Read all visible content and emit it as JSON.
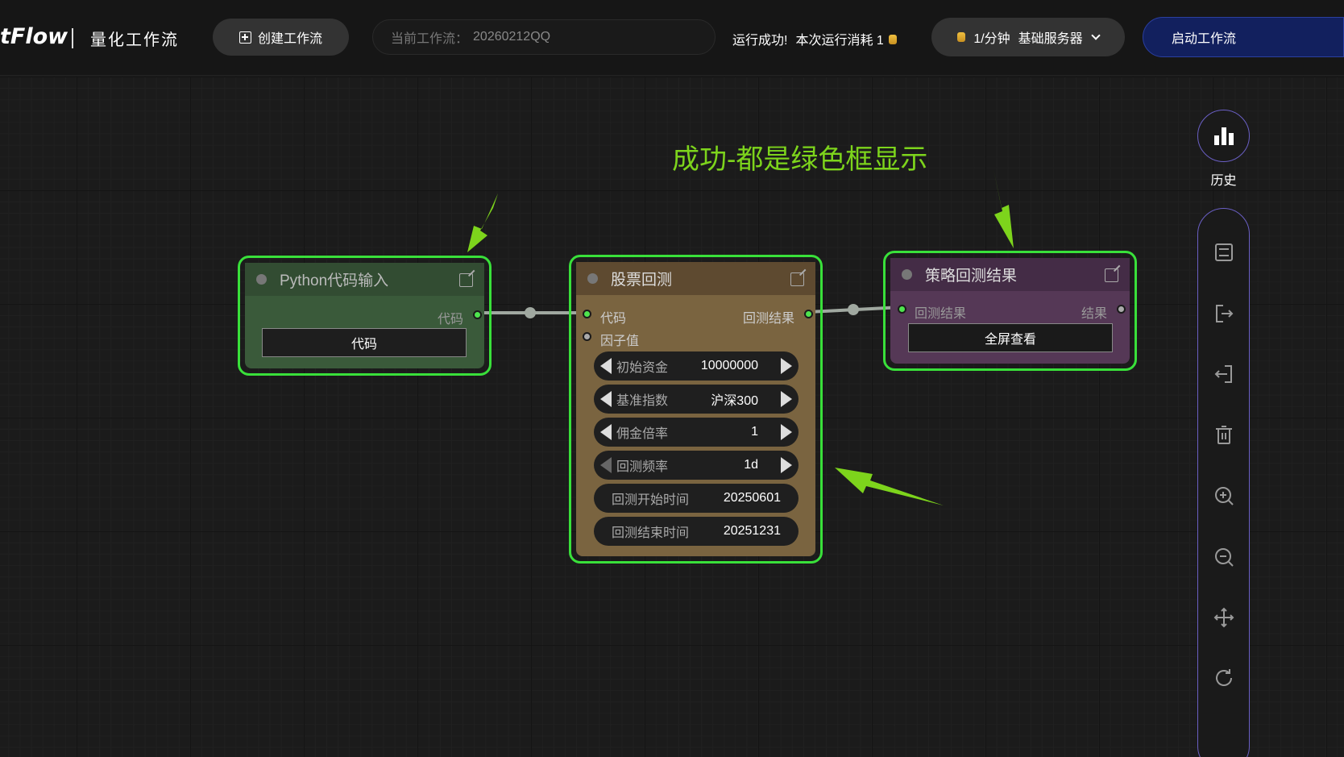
{
  "header": {
    "logo": "tFlow",
    "subtitle": "量化工作流",
    "create_label": "创建工作流",
    "workflow_prefix": "当前工作流：",
    "workflow_name": "20260212QQ",
    "status_text": "运行成功!",
    "cost_text": "本次运行消耗 1",
    "rate_text": "1/分钟",
    "server_text": "基础服务器",
    "start_label": "启动工作流"
  },
  "annotation": "成功-都是绿色框显示",
  "nodes": {
    "python": {
      "title": "Python代码输入",
      "out_label": "代码",
      "button": "代码"
    },
    "backtest": {
      "title": "股票回测",
      "in_code": "代码",
      "in_factor": "因子值",
      "out_result": "回测结果",
      "widgets": [
        {
          "label": "初始资金",
          "value": "10000000"
        },
        {
          "label": "基准指数",
          "value": "沪深300"
        },
        {
          "label": "佣金倍率",
          "value": "1"
        },
        {
          "label": "回测频率",
          "value": "1d"
        },
        {
          "label": "回测开始时间",
          "value": "20250601"
        },
        {
          "label": "回测结束时间",
          "value": "20251231"
        }
      ]
    },
    "result": {
      "title": "策略回测结果",
      "in_label": "回测结果",
      "out_label": "结果",
      "button": "全屏查看"
    }
  },
  "toolbar": {
    "history_label": "历史",
    "icons": [
      "save-icon",
      "export-icon",
      "import-icon",
      "delete-icon",
      "zoom-in-icon",
      "zoom-out-icon",
      "move-icon",
      "refresh-icon"
    ]
  },
  "colors": {
    "success_border": "#39e03a",
    "python_node": "#3a5a3a",
    "backtest_node": "#7a6440",
    "result_node": "#553856",
    "annotation": "#7dd41c",
    "start_button": "#12205e"
  }
}
